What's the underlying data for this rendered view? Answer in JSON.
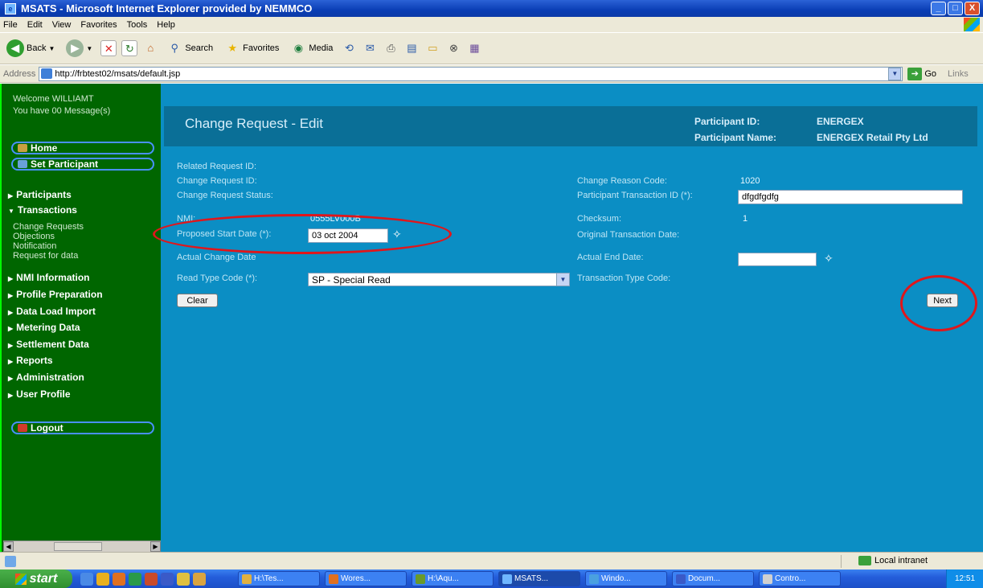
{
  "window": {
    "title": "MSATS - Microsoft Internet Explorer provided by NEMMCO",
    "minimize": "_",
    "maximize": "□",
    "close": "X"
  },
  "menu": [
    "File",
    "Edit",
    "View",
    "Favorites",
    "Tools",
    "Help"
  ],
  "toolbar": {
    "back": "Back",
    "search": "Search",
    "favorites": "Favorites",
    "media": "Media"
  },
  "address": {
    "label": "Address",
    "url": "http://frbtest02/msats/default.jsp",
    "go": "Go",
    "links": "Links"
  },
  "sidebar": {
    "welcome_line1": "Welcome WILLIAMT",
    "welcome_line2": "You have 00 Message(s)",
    "home": "Home",
    "set_participant": "Set Participant",
    "nav": [
      {
        "label": "Participants"
      },
      {
        "label": "Transactions"
      },
      {
        "label": "NMI Information"
      },
      {
        "label": "Profile Preparation"
      },
      {
        "label": "Data Load Import"
      },
      {
        "label": "Metering Data"
      },
      {
        "label": "Settlement Data"
      },
      {
        "label": "Reports"
      },
      {
        "label": "Administration"
      },
      {
        "label": "User Profile"
      }
    ],
    "transactions_sub": [
      "Change Requests",
      "Objections",
      "Notification",
      "Request for data"
    ],
    "logout": "Logout"
  },
  "header": {
    "title": "Change Request - Edit",
    "participant_id_label": "Participant ID:",
    "participant_id_value": "ENERGEX",
    "participant_name_label": "Participant Name:",
    "participant_name_value": "ENERGEX Retail Pty Ltd"
  },
  "form": {
    "related_request_id_label": "Related Request ID:",
    "change_request_id_label": "Change Request ID:",
    "change_request_status_label": "Change Request Status:",
    "nmi_label": "NMI:",
    "nmi_value": "0555LV000B",
    "proposed_start_date_label": "Proposed Start Date (*):",
    "proposed_start_date_value": "03 oct 2004",
    "actual_change_date_label": "Actual Change Date",
    "read_type_code_label": "Read Type Code (*):",
    "read_type_code_value": "SP - Special Read",
    "change_reason_code_label": "Change Reason Code:",
    "change_reason_code_value": "1020",
    "participant_transaction_id_label": "Participant Transaction ID (*):",
    "participant_transaction_id_value": "dfgdfgdfg",
    "checksum_label": "Checksum:",
    "checksum_value": "1",
    "original_transaction_date_label": "Original Transaction Date:",
    "actual_end_date_label": "Actual End Date:",
    "actual_end_date_value": "",
    "transaction_type_code_label": "Transaction Type Code:",
    "clear_button": "Clear",
    "next_button": "Next"
  },
  "annotations": {
    "highlight_color": "#e0161b"
  },
  "statusbar": {
    "zone": "Local intranet"
  },
  "taskbar": {
    "start": "start",
    "tasks": [
      "H:\\Tes...",
      "Wores...",
      "H:\\Aqu...",
      "MSATS...",
      "Windo...",
      "Docum...",
      "Contro..."
    ],
    "clock": "12:51"
  }
}
